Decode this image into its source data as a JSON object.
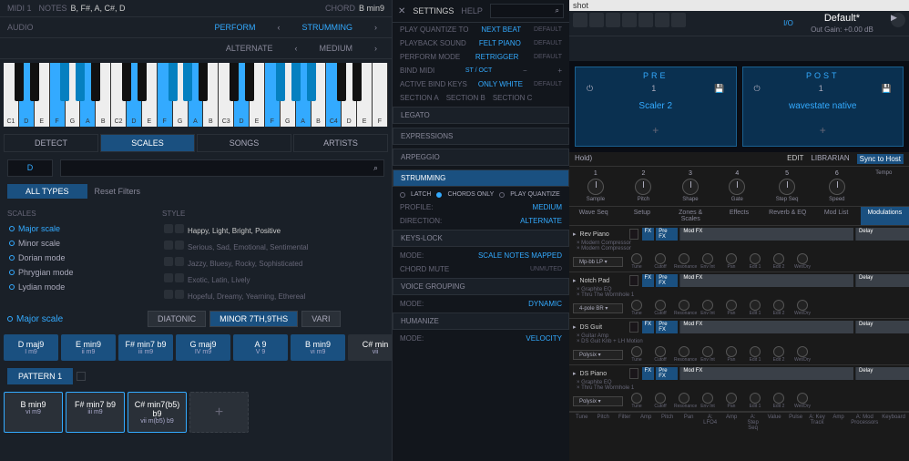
{
  "left": {
    "midi_label": "MIDI 1",
    "notes_label": "NOTES",
    "notes": "B, F#, A, C#, D",
    "chord_label": "CHORD",
    "chord": "B min9",
    "audio_label": "AUDIO",
    "top_tabs": [
      "PERFORM",
      "STRUMMING"
    ],
    "top_tabs2": [
      "ALTERNATE",
      "MEDIUM"
    ],
    "kb_labels": [
      "C1",
      "D",
      "E",
      "F",
      "G",
      "A",
      "B",
      "C2",
      "D",
      "E",
      "F",
      "G",
      "A",
      "B",
      "C3",
      "D",
      "E",
      "F",
      "G",
      "A",
      "B",
      "C4",
      "D",
      "E",
      "F"
    ],
    "cat_tabs": [
      "DETECT",
      "SCALES",
      "SONGS",
      "ARTISTS"
    ],
    "search_d": "D",
    "type_btn": "ALL TYPES",
    "reset": "Reset Filters",
    "scales_hdr": "SCALES",
    "style_hdr": "STYLE",
    "scales": [
      "Major scale",
      "Minor scale",
      "Dorian mode",
      "Phrygian mode",
      "Lydian mode"
    ],
    "styles": [
      "Happy, Light, Bright, Positive",
      "Serious, Sad, Emotional, Sentimental",
      "Jazzy, Bluesy, Rocky, Sophisticated",
      "Exotic, Latin, Lively",
      "Hopeful, Dreamy, Yearning, Ethereal"
    ],
    "sel_scale": "Major scale",
    "sel_diatonic": "DIATONIC",
    "sel_voicing": "MINOR 7TH,9THS",
    "sel_vari": "VARI",
    "chords": [
      {
        "n": "D maj9",
        "s": "I m9"
      },
      {
        "n": "E min9",
        "s": "ii m9"
      },
      {
        "n": "F# min7 b9",
        "s": "iii m9"
      },
      {
        "n": "G maj9",
        "s": "IV m9"
      },
      {
        "n": "A 9",
        "s": "V 9"
      },
      {
        "n": "B min9",
        "s": "vi m9"
      },
      {
        "n": "C# min",
        "s": "vii"
      }
    ],
    "pattern": "PATTERN 1",
    "bchords": [
      {
        "n": "B min9",
        "s": "vi m9"
      },
      {
        "n": "F# min7 b9",
        "s": "iii m9"
      },
      {
        "n": "C# min7(b5) b9",
        "s": "vii m(b5) b9"
      }
    ]
  },
  "mid": {
    "settings": "SETTINGS",
    "help": "HELP",
    "rows": [
      {
        "l": "PLAY QUANTIZE TO",
        "v": "NEXT BEAT",
        "d": "DEFAULT"
      },
      {
        "l": "PLAYBACK SOUND",
        "v": "FELT PIANO",
        "d": "DEFAULT"
      },
      {
        "l": "PERFORM MODE",
        "v": "RETRIGGER",
        "d": "DEFAULT"
      }
    ],
    "bind": "BIND MIDI",
    "bind_st": "ST / OCT",
    "active_keys": "ACTIVE BIND KEYS",
    "only_white": "ONLY WHITE",
    "sections": [
      "SECTION A",
      "SECTION B",
      "SECTION C"
    ],
    "hdrs1": [
      "LEGATO",
      "EXPRESSIONS",
      "ARPEGGIO"
    ],
    "strum": "STRUMMING",
    "radios": [
      "LATCH",
      "CHORDS ONLY",
      "PLAY QUANTIZE"
    ],
    "profile": "PROFILE:",
    "profile_v": "MEDIUM",
    "direction": "DIRECTION:",
    "direction_v": "ALTERNATE",
    "keys_lock": "KEYS-LOCK",
    "mode": "MODE:",
    "mode_v": "SCALE NOTES MAPPED",
    "chord_mute": "CHORD MUTE",
    "muted": "UNMUTED",
    "voice_grouping": "VOICE GROUPING",
    "vg_mode_v": "DYNAMIC",
    "humanize": "HUMANIZE",
    "hum_mode_v": "VELOCITY"
  },
  "right": {
    "shot": "shot",
    "title": "Default*",
    "gain": "Out Gain: +0.00 dB",
    "io": "I/O",
    "pre": "PRE",
    "post": "POST",
    "slot1": "Scaler 2",
    "slot2": "wavestate native",
    "hold": "Hold)",
    "edit": "EDIT",
    "librarian": "LIBRARIAN",
    "sync": "Sync to Host",
    "knobs": [
      {
        "n": "1",
        "l": "Sample"
      },
      {
        "n": "2",
        "l": "Pitch"
      },
      {
        "n": "3",
        "l": "Shape"
      },
      {
        "n": "4",
        "l": "Gate"
      },
      {
        "n": "5",
        "l": "Step Seq"
      },
      {
        "n": "6",
        "l": "Speed"
      }
    ],
    "tempo": "Tempo",
    "tabs": [
      "Wave Seq",
      "Setup",
      "Zones & Scales",
      "Effects",
      "Reverb & EQ",
      "Mod List",
      "Modulations"
    ],
    "lanes": [
      {
        "name": "Rev Piano",
        "preset": "Mp-bb LP",
        "sub1": "Modern Compressor",
        "sub2": "Modern Compressor"
      },
      {
        "name": "Notch Pad",
        "preset": "4-pole BR",
        "sub1": "Graphite EQ",
        "sub2": "Thru The Wormhole 1"
      },
      {
        "name": "DS Guit",
        "preset": "Polysix",
        "sub1": "Guitar Amp",
        "sub2": "DS Guit Knb + LH Motion"
      },
      {
        "name": "DS Piano",
        "preset": "Polysix",
        "sub1": "Graphite EQ",
        "sub2": "Thru The Wormhole 1"
      }
    ],
    "fx_labels": [
      "FX",
      "Pre FX",
      "Mod FX",
      "Delay"
    ],
    "mini_labels": [
      "Tune",
      "Cutoff",
      "Resonance",
      "Env Int",
      "Pan",
      "Edit 1",
      "Edit 2",
      "Wet/Dry"
    ],
    "bot": [
      "Tune",
      "Pitch",
      "Filter",
      "Amp",
      "Pitch",
      "Pan",
      "A: LFO4",
      "Amp",
      "A: Step Seq",
      "Value",
      "Pulse",
      "A: Key Track",
      "Amp",
      "A: Mod Processors",
      "Keyboard"
    ]
  }
}
